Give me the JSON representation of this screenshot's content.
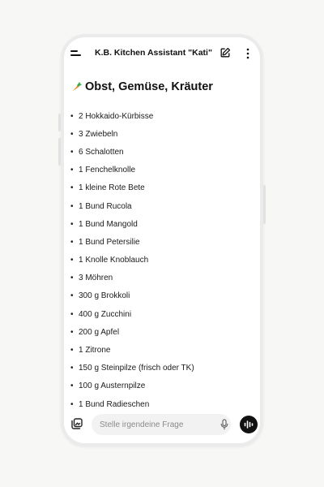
{
  "header": {
    "title": "K.B. Kitchen Assistant \"Kati\"",
    "menu_icon": "hamburger-menu-icon",
    "edit_icon": "new-chat-pencil-icon",
    "more_icon": "kebab-more-icon"
  },
  "section": {
    "emoji_icon": "carrot-icon",
    "heading": "Obst, Gemüse, Kräuter",
    "items": [
      {
        "text": "2 Hokkaido-Kürbisse"
      },
      {
        "text": "3 Zwiebeln"
      },
      {
        "text": "6 Schalotten"
      },
      {
        "text": "1 Fenchelknolle"
      },
      {
        "text": "1 kleine Rote Bete"
      },
      {
        "text": "1 Bund Rucola"
      },
      {
        "text": "1 Bund Mangold"
      },
      {
        "text": "1 Bund Petersilie"
      },
      {
        "text": "1 Knolle Knoblauch"
      },
      {
        "text": "3 Möhren"
      },
      {
        "text": "300 g Brokkoli"
      },
      {
        "text": "400 g Zucchini"
      },
      {
        "text": "200 g Apfel"
      },
      {
        "text": "1 Zitrone"
      },
      {
        "text": "150 g Steinpilze (frisch oder TK)"
      },
      {
        "text": "100 g Austernpilze"
      },
      {
        "text": "1 Bund Radieschen"
      }
    ]
  },
  "composer": {
    "placeholder": "Stelle irgendeine Frage",
    "attach_icon": "attachment-icon",
    "mic_icon": "microphone-icon",
    "voice_icon": "voice-mode-icon"
  },
  "colors": {
    "background": "#f7f7f5",
    "frame": "#ebebeb",
    "screen": "#ffffff",
    "text": "#111111",
    "accent_carrot": "#f08a24"
  }
}
